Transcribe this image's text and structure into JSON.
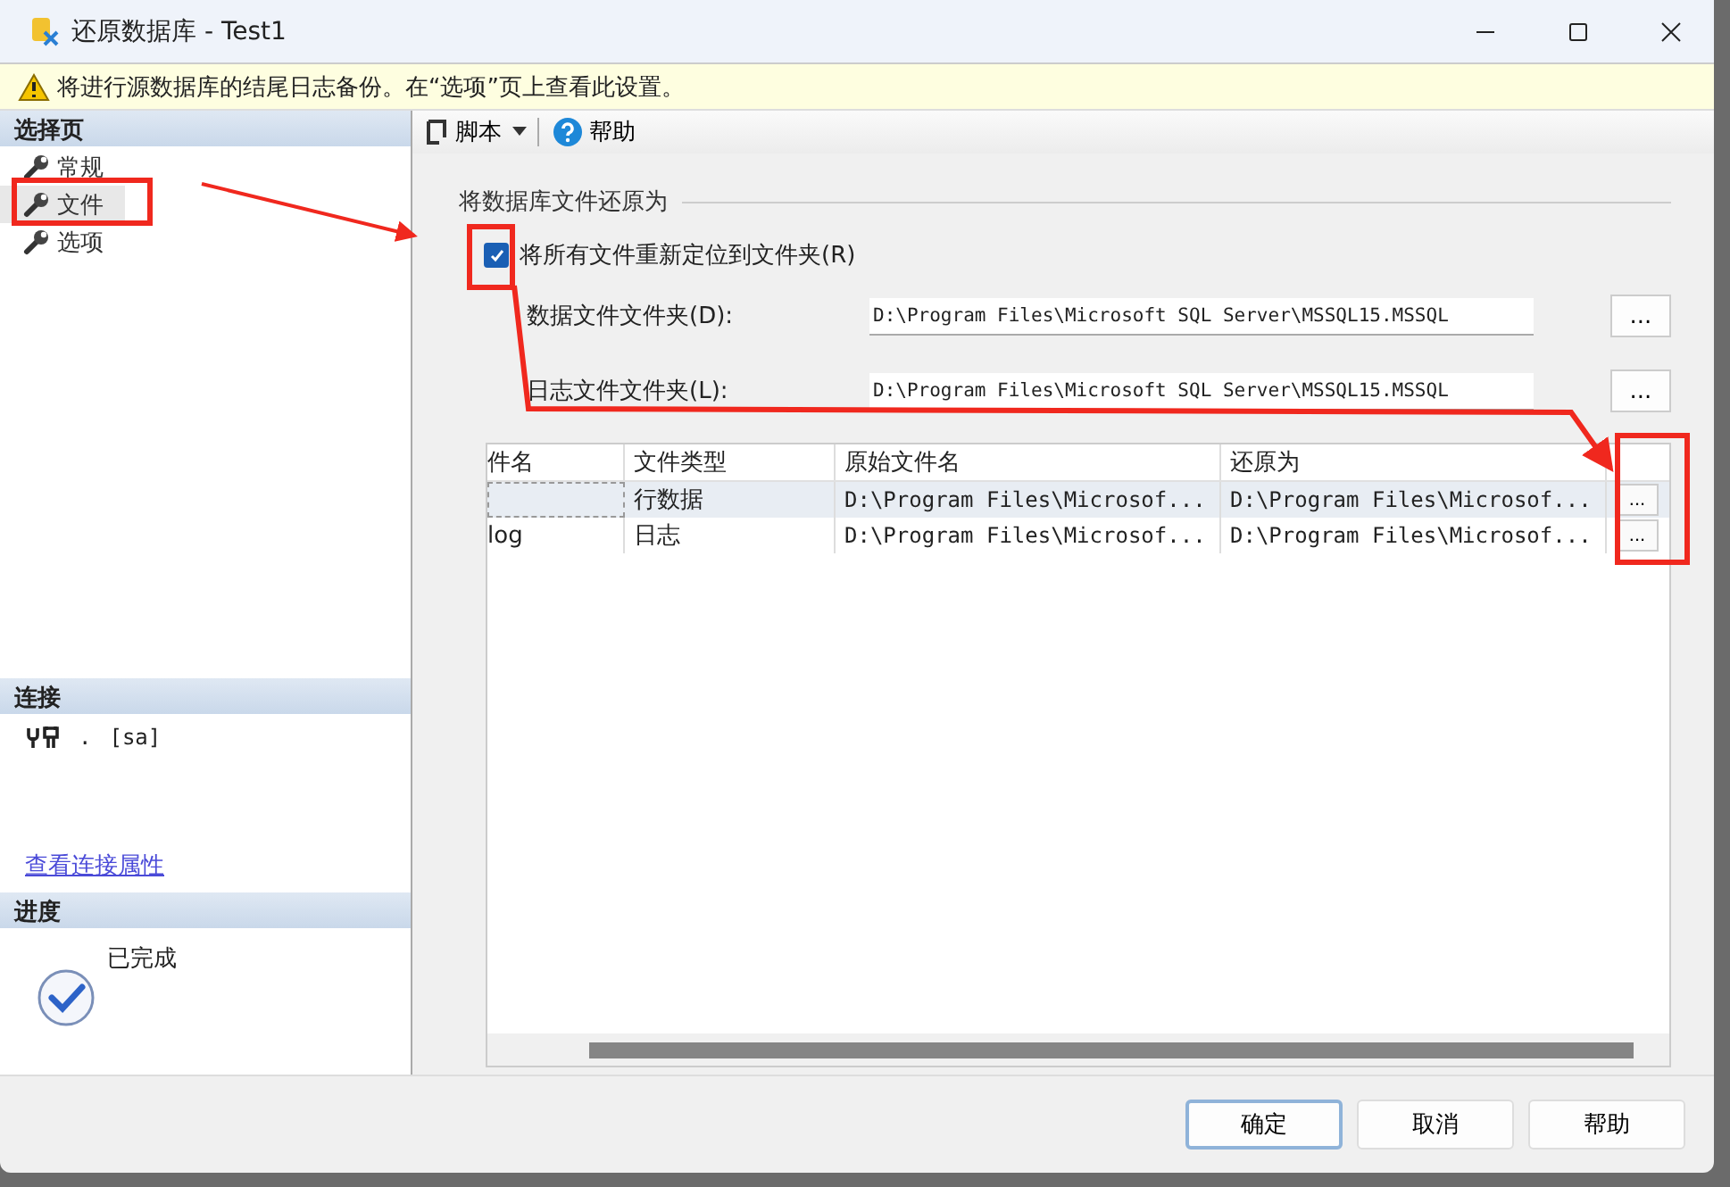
{
  "window": {
    "title": "还原数据库 - Test1"
  },
  "warning": "将进行源数据库的结尾日志备份。在“选项”页上查看此设置。",
  "select_page": {
    "title": "选择页",
    "items": [
      {
        "label": "常规",
        "selected": false
      },
      {
        "label": "文件",
        "selected": true
      },
      {
        "label": "选项",
        "selected": false
      }
    ]
  },
  "connection": {
    "title": "连接",
    "server": ".",
    "user": "[sa]",
    "link": "查看连接属性"
  },
  "progress": {
    "title": "进度",
    "status": "已完成"
  },
  "toolbar": {
    "script": "脚本",
    "help": "帮助"
  },
  "group_title": "将数据库文件还原为",
  "relocate": {
    "label": "将所有文件重新定位到文件夹(R)",
    "checked": true
  },
  "folders": [
    {
      "label": "数据文件文件夹(D):",
      "value": "D:\\Program Files\\Microsoft SQL Server\\MSSQL15.MSSQL",
      "button": "..."
    },
    {
      "label": "日志文件文件夹(L):",
      "value": "D:\\Program Files\\Microsoft SQL Server\\MSSQL15.MSSQL",
      "button": "..."
    }
  ],
  "table": {
    "columns": [
      "件名",
      "文件类型",
      "原始文件名",
      "还原为"
    ],
    "rows": [
      {
        "type": "行数据",
        "original": "D:\\Program Files\\Microsof...",
        "restore_as": "D:\\Program Files\\Microsof...",
        "button": "...",
        "selected": true
      },
      {
        "name": "log",
        "type": "日志",
        "original": "D:\\Program Files\\Microsof...",
        "restore_as": "D:\\Program Files\\Microsof...",
        "button": "...",
        "selected": false
      }
    ]
  },
  "buttons": [
    {
      "label": "确定",
      "default": true
    },
    {
      "label": "取消",
      "default": false
    },
    {
      "label": "帮助",
      "default": false
    }
  ]
}
